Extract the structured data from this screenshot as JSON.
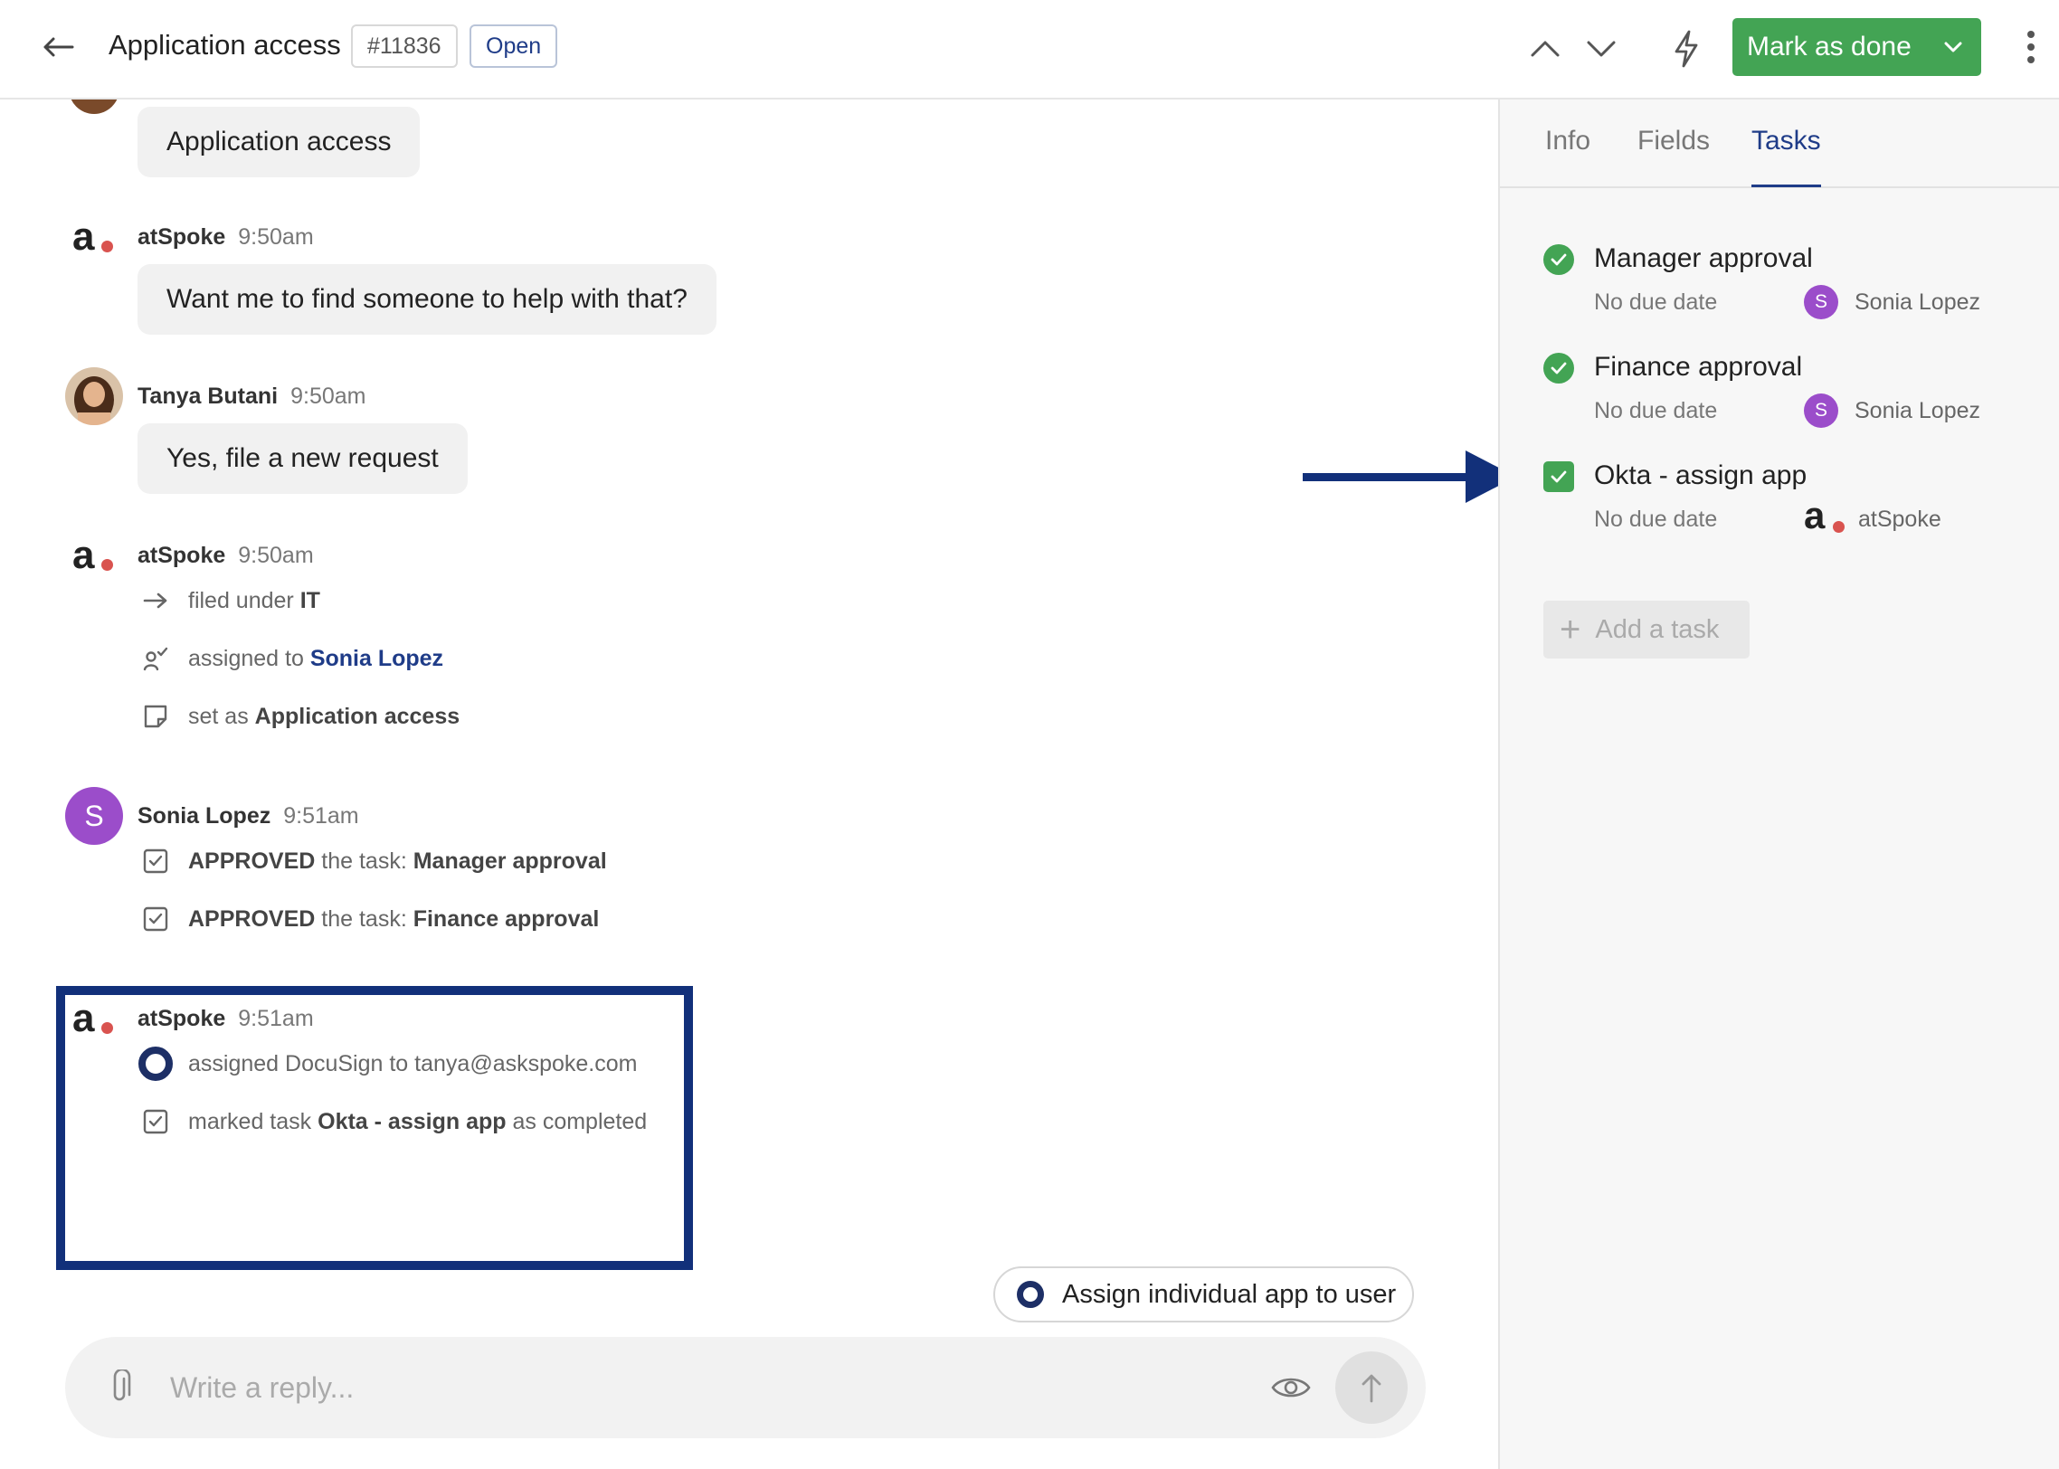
{
  "header": {
    "title": "Application access",
    "ticket_id": "#11836",
    "status": "Open",
    "primary_action": "Mark as done"
  },
  "conversation": {
    "request_bubble": "Application access",
    "messages": [
      {
        "author": "atSpoke",
        "time": "9:50am",
        "text": "Want me to find someone to help with that?"
      },
      {
        "author": "Tanya Butani",
        "time": "9:50am",
        "text": "Yes, file a new request"
      },
      {
        "author": "atSpoke",
        "time": "9:50am",
        "events": [
          {
            "prefix": "filed under",
            "value": "IT"
          },
          {
            "prefix": "assigned to",
            "value": "Sonia Lopez"
          },
          {
            "prefix": "set as",
            "value": "Application access"
          }
        ]
      },
      {
        "author": "Sonia Lopez",
        "avatar_letter": "S",
        "time": "9:51am",
        "events": [
          {
            "action": "APPROVED",
            "middle": "the task:",
            "value": "Manager approval"
          },
          {
            "action": "APPROVED",
            "middle": "the task:",
            "value": "Finance approval"
          }
        ]
      },
      {
        "author": "atSpoke",
        "time": "9:51am",
        "events": [
          {
            "text": "assigned DocuSign to tanya@askspoke.com"
          },
          {
            "prefix": "marked task",
            "value": "Okta - assign app",
            "suffix": "as completed"
          }
        ]
      }
    ],
    "suggestion": "Assign individual app to user",
    "reply_placeholder": "Write a reply..."
  },
  "panel": {
    "tabs": [
      "Info",
      "Fields",
      "Tasks"
    ],
    "active_tab": "Tasks",
    "tasks": [
      {
        "name": "Manager approval",
        "due": "No due date",
        "assignee": "Sonia Lopez",
        "assignee_letter": "S",
        "status": "completed"
      },
      {
        "name": "Finance approval",
        "due": "No due date",
        "assignee": "Sonia Lopez",
        "assignee_letter": "S",
        "status": "completed"
      },
      {
        "name": "Okta - assign app",
        "due": "No due date",
        "assignee": "atSpoke",
        "status": "checked"
      }
    ],
    "add_task_label": "Add a task"
  },
  "colors": {
    "accent_blue": "#1f3c88",
    "highlight_navy": "#12307a",
    "success_green": "#43a454",
    "avatar_purple": "#9b4dca",
    "logo_dot_red": "#d9534f"
  },
  "icons": [
    "back-arrow-icon",
    "chevron-up-icon",
    "chevron-down-icon",
    "lightning-icon",
    "more-vertical-icon",
    "arrow-right-icon",
    "assign-user-icon",
    "note-icon",
    "checkbox-icon",
    "paperclip-icon",
    "eye-icon",
    "send-arrow-icon",
    "check-icon",
    "plus-icon"
  ]
}
